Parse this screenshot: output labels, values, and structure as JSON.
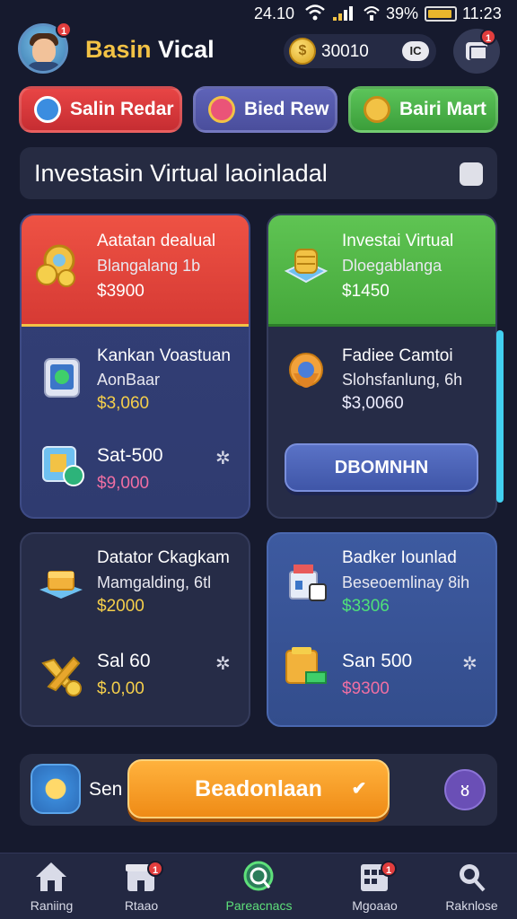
{
  "status_bar": {
    "time": "24.10",
    "battery_text": "39%",
    "clock": "11:23"
  },
  "header": {
    "avatar_badge": "1",
    "title_part1": "Basin",
    "title_part2": "Vical",
    "coin_value": "30010",
    "coin_symbol": "$",
    "coin_toggle": "IC",
    "wallet_badge": "1"
  },
  "top_buttons": [
    {
      "label": "Salin Redar",
      "icon": "check-shield-icon"
    },
    {
      "label": "Bied Rew",
      "icon": "badge-icon"
    },
    {
      "label": "Bairi Mart",
      "icon": "coin-icon"
    }
  ],
  "section": {
    "title": "Investasin Virtual laoinladal",
    "icon": "puzzle-icon"
  },
  "cards": {
    "a": {
      "head": {
        "title": "Aatatan dealual",
        "sub": "Blangalang 1b",
        "price": "$3900"
      },
      "item1": {
        "title": "Kankan Voastuan",
        "sub": "AonBaar",
        "price": "$3,060"
      },
      "item2": {
        "title": "Sat-500",
        "price": "$9,000"
      }
    },
    "b": {
      "head": {
        "title": "Investai Virtual",
        "sub": "Dloegablanga",
        "price": "$1450"
      },
      "item1": {
        "title": "Fadiee Camtoi",
        "sub": "Slohsfanlung, 6h",
        "price": "$3,0060"
      },
      "button": "DBOMNHN"
    },
    "c": {
      "item1": {
        "title": "Datator Ckagkam",
        "sub": "Mamgalding, 6tl",
        "price": "$2000"
      },
      "item2": {
        "title": "Sal 60",
        "price": "$.0,00"
      }
    },
    "d": {
      "item1": {
        "title": "Badker Iounlad",
        "sub": "Beseoemlinay 8ih",
        "price": "$3306"
      },
      "item2": {
        "title": "San 500",
        "price": "$9300"
      }
    }
  },
  "action_bar": {
    "label": "Sen",
    "main_button": "Beadonlaan",
    "check": "✔",
    "round_glyph": "ᴕ"
  },
  "bottom_nav": [
    {
      "label": "Raniing",
      "icon": "home-icon",
      "badge": ""
    },
    {
      "label": "Rtaao",
      "icon": "shop-icon",
      "badge": "1"
    },
    {
      "label": "Pareacnacs",
      "icon": "search-globe-icon",
      "badge": "",
      "active": true
    },
    {
      "label": "Mgoaao",
      "icon": "calendar-icon",
      "badge": "1"
    },
    {
      "label": "Raknlose",
      "icon": "magnifier-icon",
      "badge": ""
    }
  ],
  "colors": {
    "background": "#161a2e",
    "accent_yellow": "#f2c245",
    "accent_green": "#4fe07a",
    "accent_red": "#e84545",
    "accent_orange": "#ef8b16"
  },
  "star_glyph": "✲"
}
